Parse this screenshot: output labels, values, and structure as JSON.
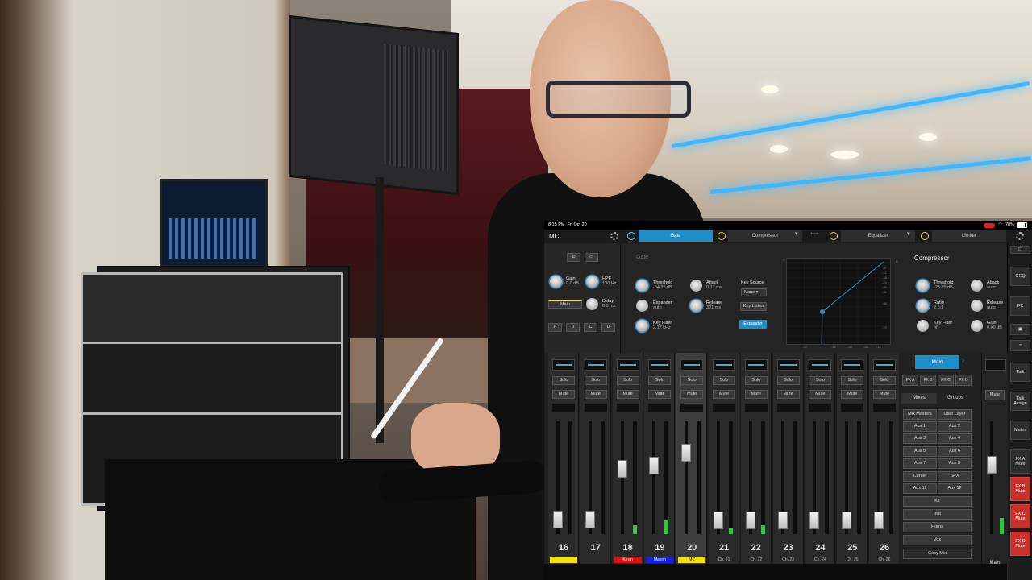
{
  "status_bar": {
    "time": "8:15 PM",
    "date": "Fri Oct 20",
    "battery": "78%"
  },
  "channel": {
    "name": "MC"
  },
  "top_tabs": {
    "gate": "Gate",
    "compressor": "Compressor",
    "equalizer": "Equalizer",
    "limiter": "Limiter"
  },
  "left_panel": {
    "phase_icon": "Ø",
    "gain": {
      "label": "Gain",
      "value": "0.0 dB"
    },
    "hpf": {
      "label": "HPF",
      "value": "100 Hz"
    },
    "main_label": "Main",
    "delay": {
      "label": "Delay",
      "value": "0.0 ms"
    },
    "buttons": [
      "A",
      "B",
      "C",
      "D"
    ]
  },
  "gate": {
    "title": "Gate",
    "threshold": {
      "label": "Threshold",
      "value": "-54.35 dB"
    },
    "attack": {
      "label": "Attack",
      "value": "0.17 ms"
    },
    "expander": {
      "label": "Expander",
      "value": "auto"
    },
    "release": {
      "label": "Release",
      "value": "301 ms"
    },
    "key_filter": {
      "label": "Key Filter",
      "value": "2.17 kHz"
    },
    "key_source": {
      "label": "Key Source",
      "value": "None"
    },
    "key_listen": "Key Listen",
    "expander_btn": "Expander"
  },
  "graph": {
    "y_ticks": [
      "0",
      "-6",
      "-12",
      "-18",
      "-24",
      "-30",
      "-36",
      "-42",
      "-48",
      "-60",
      "-72"
    ],
    "x_ticks": [
      "-72",
      "-48",
      "-36",
      "-24",
      "-12",
      "0"
    ]
  },
  "compressor": {
    "title": "Compressor",
    "threshold": {
      "label": "Threshold",
      "value": "-23.85 dB"
    },
    "attack": {
      "label": "Attack",
      "value": "auto"
    },
    "ratio": {
      "label": "Ratio",
      "value": "2.5:1"
    },
    "release": {
      "label": "Release",
      "value": "auto"
    },
    "key_filter": {
      "label": "Key Filter",
      "value": "off"
    },
    "gain": {
      "label": "Gain",
      "value": "0.00 dB"
    }
  },
  "right_rail": [
    "GEQ",
    "FX",
    "Talk",
    "Talk Assign",
    "Mutes",
    "FX A Mute",
    "FX B Mute",
    "FX C Mute",
    "FX D Mute"
  ],
  "strip_buttons": {
    "solo": "Solo",
    "mute": "Mute"
  },
  "channels": [
    {
      "num": "16",
      "tag": "",
      "color": "#f5e000"
    },
    {
      "num": "17",
      "tag": "",
      "color": ""
    },
    {
      "num": "18",
      "tag": "Kevin",
      "color": "#e01010"
    },
    {
      "num": "19",
      "tag": "Mason",
      "color": "#1020e8"
    },
    {
      "num": "20",
      "tag": "MC",
      "color": "#f5e000"
    },
    {
      "num": "21",
      "tag": "Ch. 21",
      "color": ""
    },
    {
      "num": "22",
      "tag": "Ch. 22",
      "color": ""
    },
    {
      "num": "23",
      "tag": "Ch. 23",
      "color": ""
    },
    {
      "num": "24",
      "tag": "Ch. 24",
      "color": ""
    },
    {
      "num": "25",
      "tag": "Ch. 25",
      "color": ""
    },
    {
      "num": "26",
      "tag": "Ch. 26",
      "color": ""
    }
  ],
  "mix_panel": {
    "main": "Main",
    "fx": [
      "FX A",
      "FX B",
      "FX C",
      "FX D"
    ],
    "tabs": [
      "Mixes",
      "Groups"
    ],
    "mute": "Mute",
    "mix_masters": "Mix Masters",
    "user_layer": "User Layer",
    "aux_left": [
      "Aux 1",
      "Aux 3",
      "Aux 5",
      "Aux 7"
    ],
    "aux_right": [
      "Aux 2",
      "Aux 4",
      "Aux 6",
      "Aux 8"
    ],
    "center": "Center",
    "spx": "SPX",
    "aux11": "Aux 11",
    "aux12": "Aux 12",
    "groups": [
      "Kit",
      "Inst",
      "Horns",
      "Vox"
    ],
    "copy_mix": "Copy Mix",
    "main_label": "Main"
  }
}
